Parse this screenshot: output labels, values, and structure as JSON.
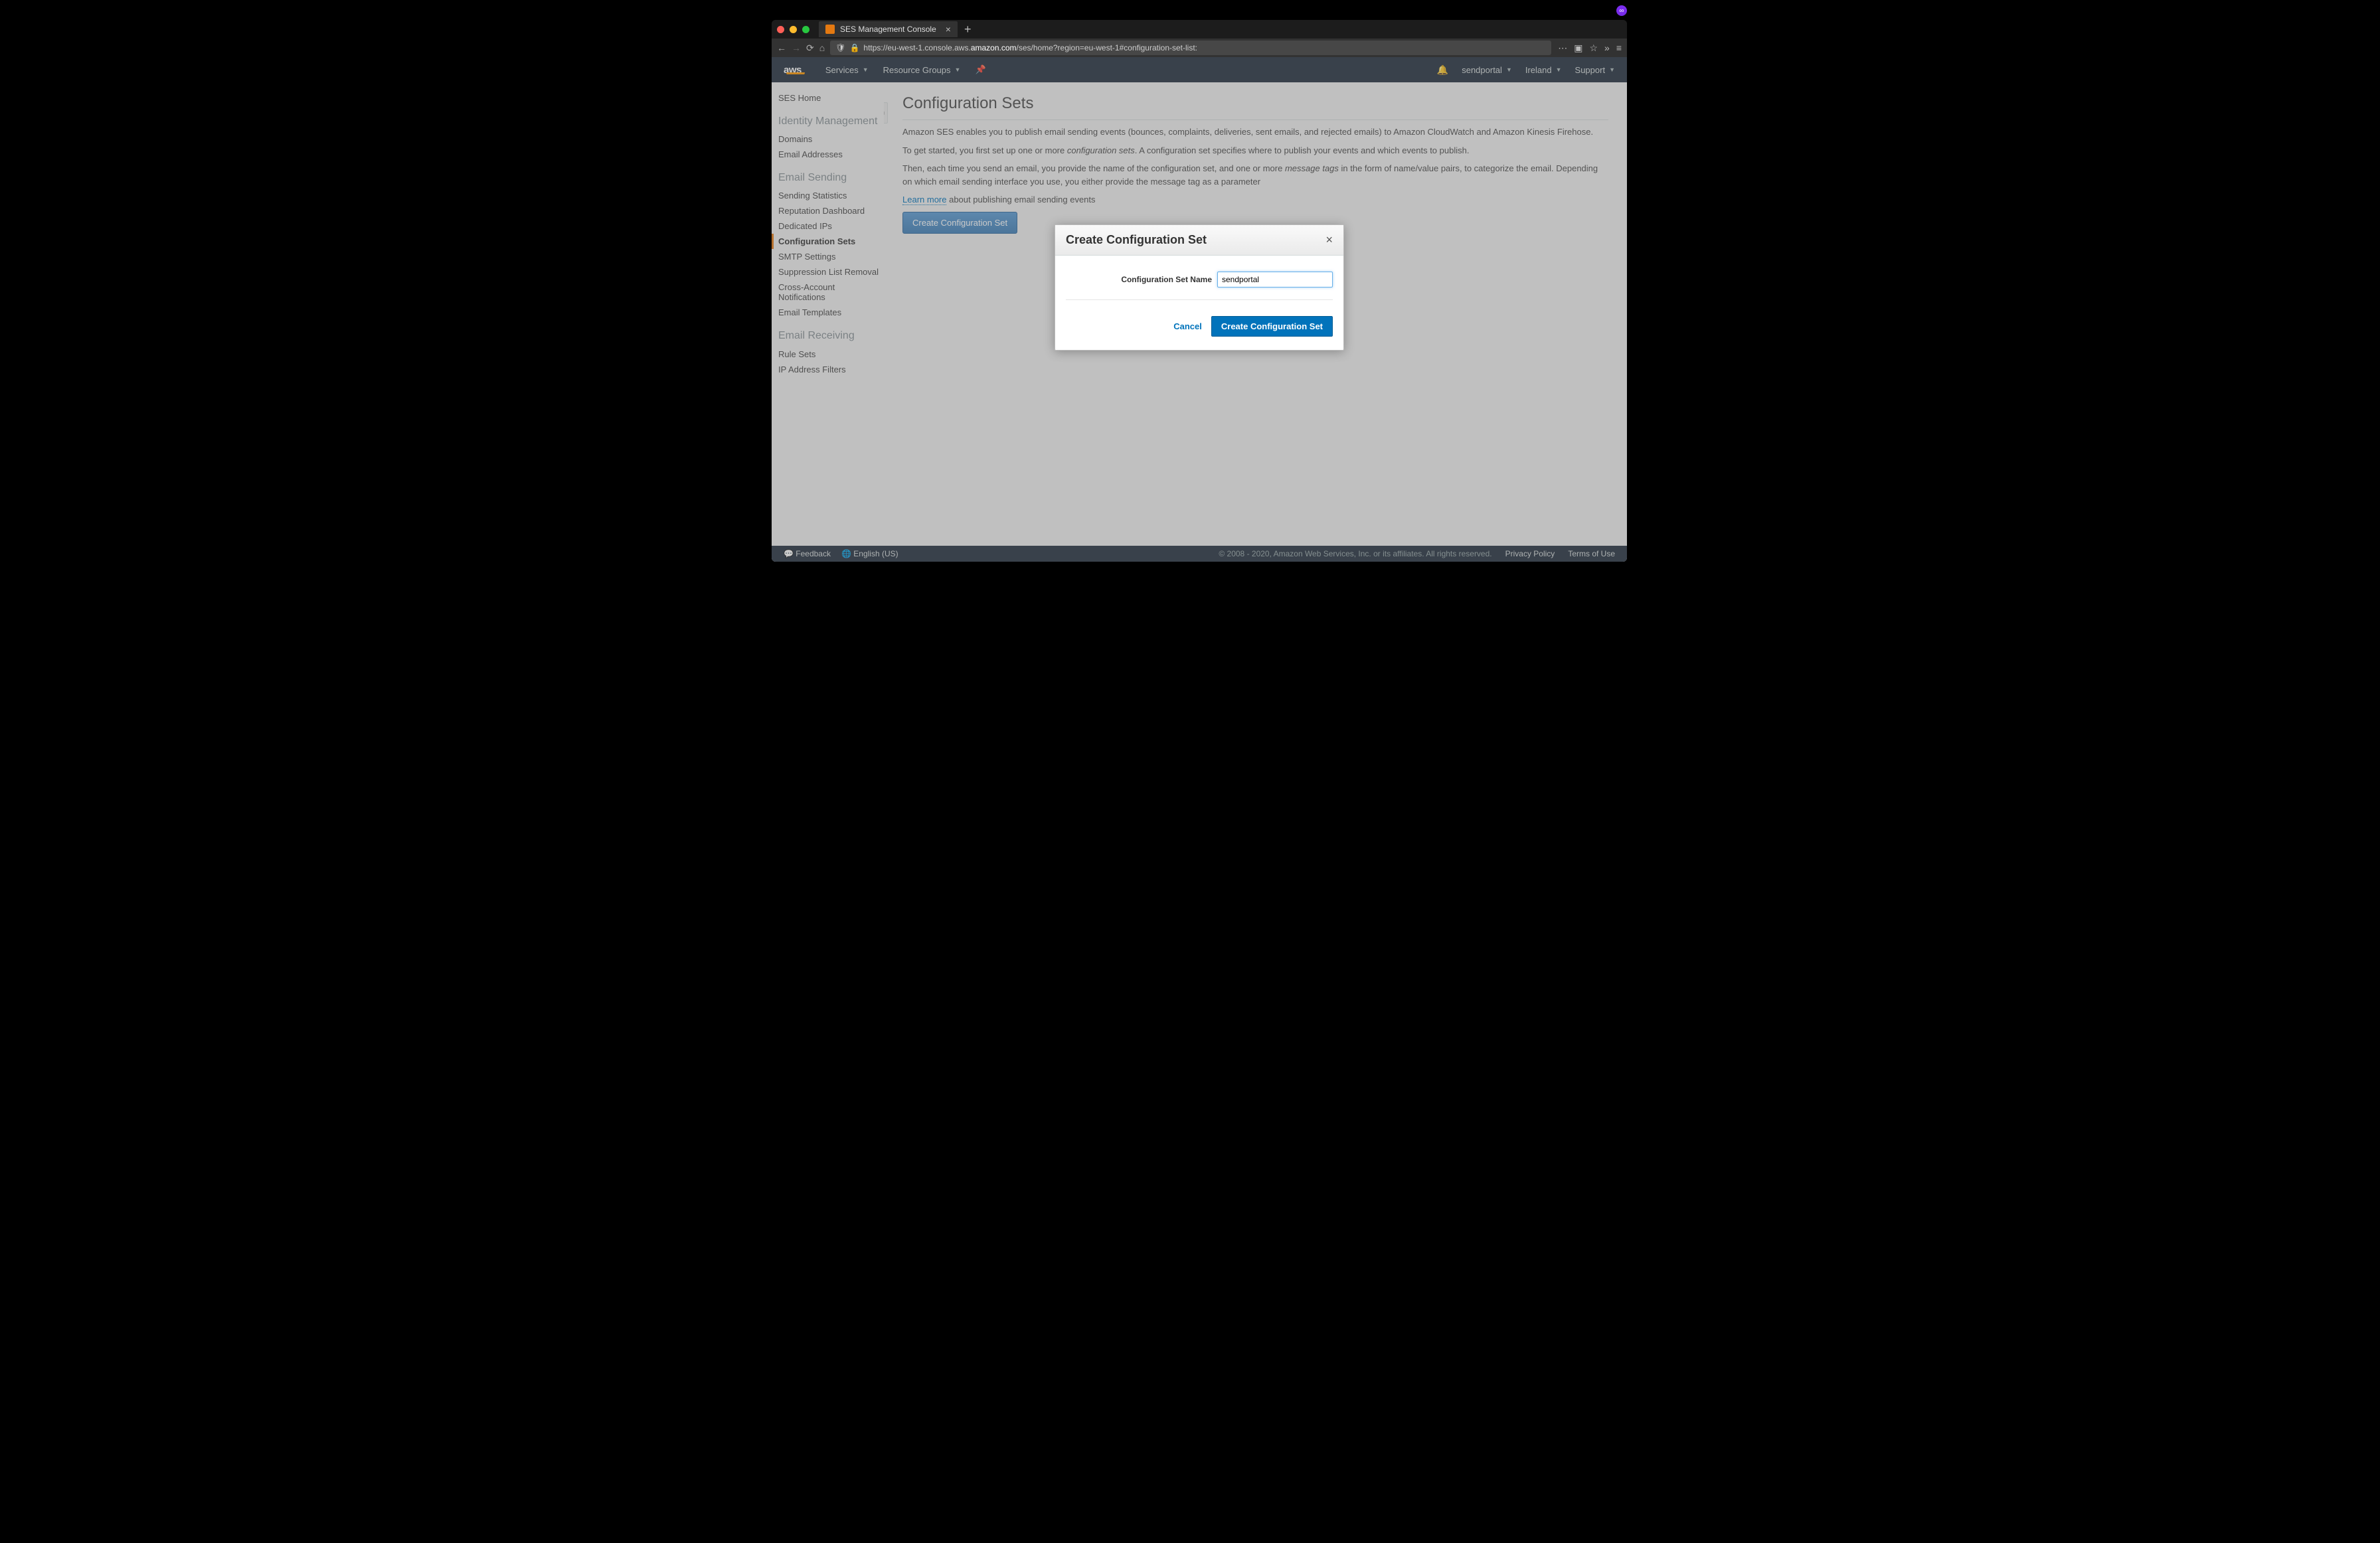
{
  "browser": {
    "tab_title": "SES Management Console",
    "url_pre": "https://eu-west-1.console.aws.",
    "url_host": "amazon.com",
    "url_post": "/ses/home?region=eu-west-1#configuration-set-list:"
  },
  "header": {
    "logo": "aws",
    "services": "Services",
    "resource_groups": "Resource Groups",
    "account": "sendportal",
    "region": "Ireland",
    "support": "Support"
  },
  "sidebar": {
    "home": "SES Home",
    "section_identity": "Identity Management",
    "domains": "Domains",
    "emails": "Email Addresses",
    "section_sending": "Email Sending",
    "sending_stats": "Sending Statistics",
    "reputation": "Reputation Dashboard",
    "dedicated_ips": "Dedicated IPs",
    "config_sets": "Configuration Sets",
    "smtp": "SMTP Settings",
    "suppression": "Suppression List Removal",
    "cross_account": "Cross-Account Notifications",
    "templates": "Email Templates",
    "section_receiving": "Email Receiving",
    "rule_sets": "Rule Sets",
    "ip_filters": "IP Address Filters"
  },
  "page": {
    "title": "Configuration Sets",
    "p1": "Amazon SES enables you to publish email sending events (bounces, complaints, deliveries, sent emails, and rejected emails) to Amazon CloudWatch and Amazon Kinesis Firehose.",
    "p2a": "To get started, you first set up one or more ",
    "p2_em": "configuration sets",
    "p2b": ". A configuration set specifies where to publish your events and which events to publish.",
    "p3a": "Then, each time you send an email, you provide the name of the configuration set, and one or more ",
    "p3_em": "message tags",
    "p3b": " in the form of name/value pairs, to categorize the email. Depending on which email sending interface you use, you either provide the message tag as a parameter",
    "learn_more": "Learn more",
    "learn_suffix": " about publishing email sending events",
    "create_btn": "Create Configuration Set"
  },
  "modal": {
    "title": "Create Configuration Set",
    "field_label": "Configuration Set Name",
    "field_value": "sendportal",
    "cancel": "Cancel",
    "confirm": "Create Configuration Set"
  },
  "footer": {
    "feedback": "Feedback",
    "language": "English (US)",
    "copyright": "© 2008 - 2020, Amazon Web Services, Inc. or its affiliates. All rights reserved.",
    "privacy": "Privacy Policy",
    "terms": "Terms of Use"
  }
}
